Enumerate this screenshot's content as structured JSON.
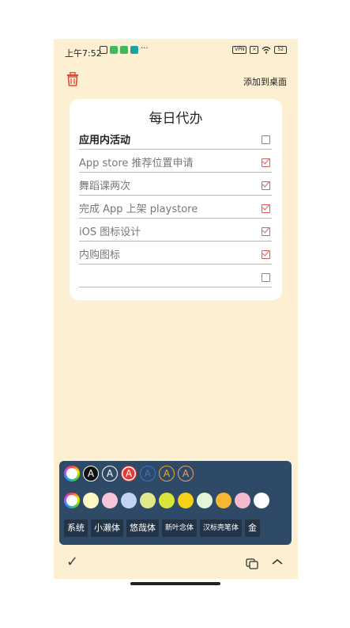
{
  "status_bar": {
    "time": "上午7:52",
    "more": "···",
    "vpn": "VPN",
    "battery": "52"
  },
  "header": {
    "add_to_desktop": "添加到桌面"
  },
  "card": {
    "title": "每日代办",
    "items": [
      {
        "text": "应用内活动",
        "checked": false
      },
      {
        "text": "App store 推荐位置申请",
        "checked": true
      },
      {
        "text": "舞蹈课两次",
        "checked": true
      },
      {
        "text": "完成 App 上架 playstore",
        "checked": true
      },
      {
        "text": "iOS 图标设计",
        "checked": true
      },
      {
        "text": "内购图标",
        "checked": true
      },
      {
        "text": "",
        "checked": false
      }
    ]
  },
  "palette": {
    "text_colors": [
      "#111111",
      "#ffffff",
      "#e53935",
      "#3f6fd8",
      "#f5a623",
      "#f39c6b"
    ],
    "glyph": "A",
    "bg_colors": [
      "#fff7c2",
      "#f7c6d6",
      "#c3d3f3",
      "#e2e98a",
      "#d8e63a",
      "#f7d117",
      "#e3f6d8",
      "#f7b733",
      "#f5b9cc",
      "#ffffff"
    ],
    "fonts": [
      "系统",
      "小濑体",
      "悠哉体",
      "新叶念体",
      "汉标壳笔体",
      "金"
    ]
  }
}
